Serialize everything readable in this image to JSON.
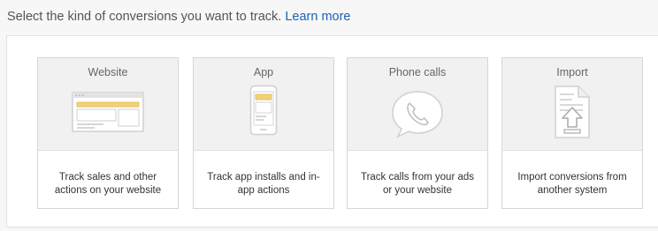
{
  "intro": {
    "text": "Select the kind of conversions you want to track.",
    "link": "Learn more"
  },
  "cards": [
    {
      "title": "Website",
      "icon": "website-icon",
      "desc_line1": "Track sales and other",
      "desc_line2": "actions on your website"
    },
    {
      "title": "App",
      "icon": "app-phone-icon",
      "desc_line1": "Track app installs and in-",
      "desc_line2": "app actions"
    },
    {
      "title": "Phone calls",
      "icon": "phone-call-icon",
      "desc_line1": "Track calls from your ads",
      "desc_line2": "or your website"
    },
    {
      "title": "Import",
      "icon": "import-file-icon",
      "desc_line1": "Import conversions from",
      "desc_line2": "another system"
    }
  ],
  "colors": {
    "link": "#1a62b7",
    "accent": "#f4c542",
    "panel_bg": "#ffffff",
    "card_top_bg": "#f1f1f1"
  }
}
